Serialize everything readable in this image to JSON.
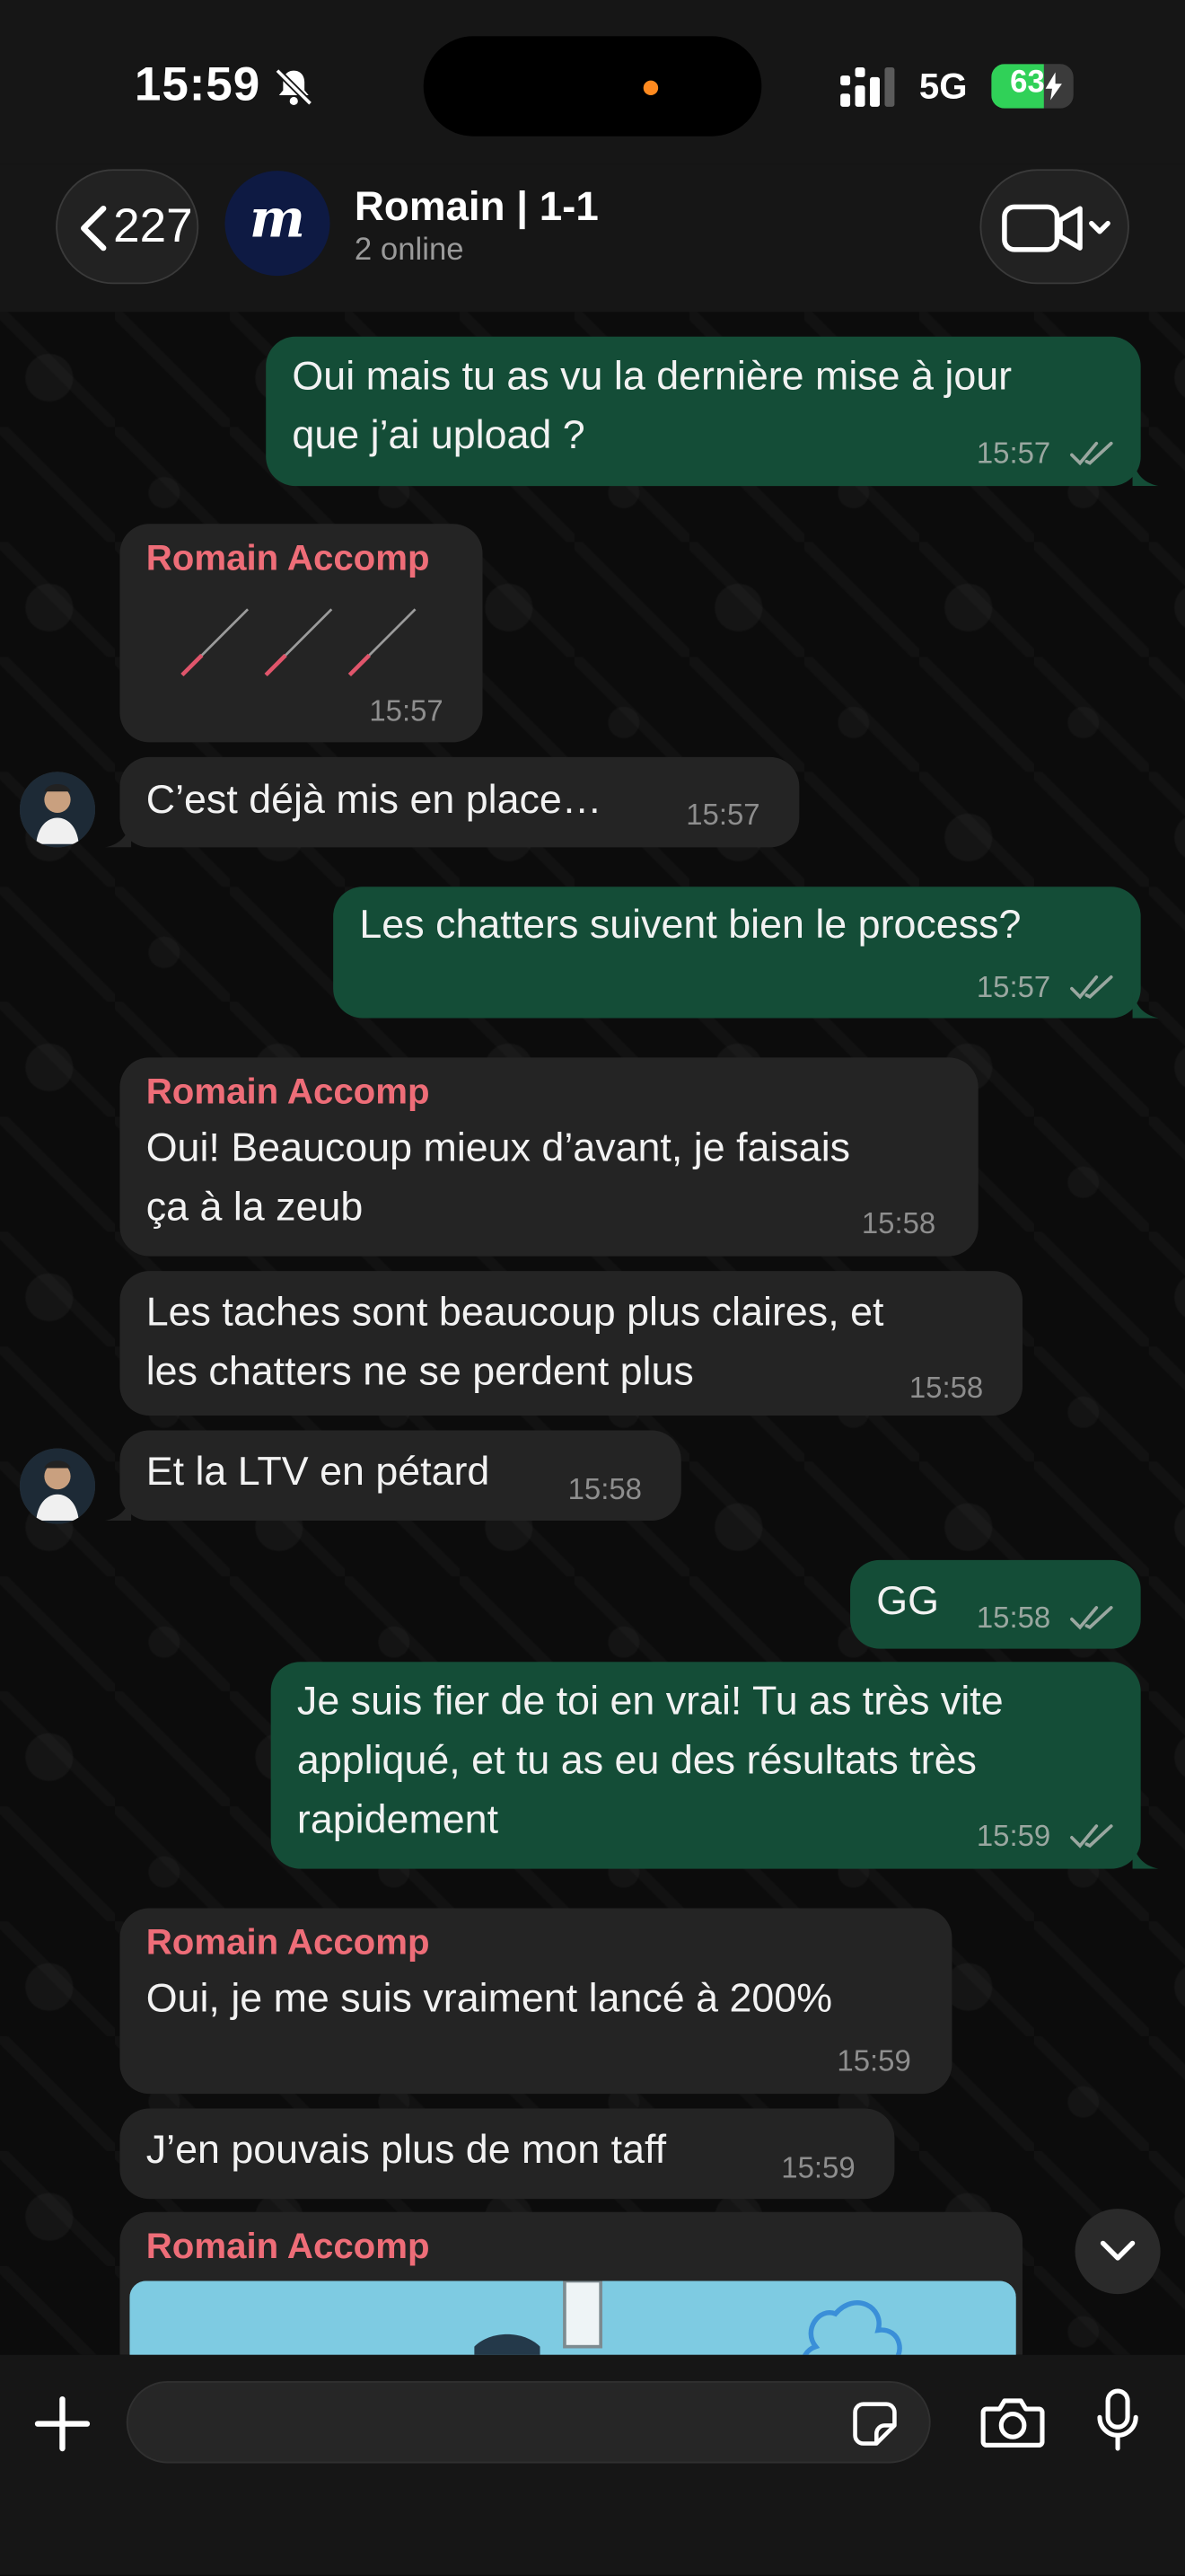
{
  "status_bar": {
    "time": "15:59",
    "network": "5G",
    "battery": "63",
    "battery_level": 0.63
  },
  "header": {
    "back_count": "227",
    "chat_title": "Romain | 1-1",
    "chat_subtitle": "2 online",
    "logo_letter": "m"
  },
  "messages": [
    {
      "dir": "out",
      "lines": [
        "Oui mais tu as vu la dernière mise à jour",
        "que j’ai upload ?"
      ],
      "time": "15:57",
      "status": "read"
    },
    {
      "dir": "in",
      "sender": "Romain Accomp",
      "content": "stickers",
      "time": "15:57"
    },
    {
      "dir": "in",
      "lines": [
        "C’est déjà mis en place…"
      ],
      "time": "15:57"
    },
    {
      "dir": "out",
      "lines": [
        "Les chatters suivent bien le process?"
      ],
      "time": "15:57",
      "status": "read"
    },
    {
      "dir": "in",
      "sender": "Romain Accomp",
      "lines": [
        "Oui! Beaucoup mieux d’avant, je faisais",
        "ça à la zeub"
      ],
      "time": "15:58"
    },
    {
      "dir": "in",
      "lines": [
        "Les taches sont beaucoup plus claires, et",
        "les chatters ne se perdent plus"
      ],
      "time": "15:58"
    },
    {
      "dir": "in",
      "lines": [
        "Et la LTV en pétard"
      ],
      "time": "15:58"
    },
    {
      "dir": "out",
      "lines": [
        "GG"
      ],
      "time": "15:58",
      "status": "read"
    },
    {
      "dir": "out",
      "lines": [
        "Je suis fier de toi en vrai! Tu as très vite",
        "appliqué, et tu as eu des résultats très",
        "rapidement"
      ],
      "time": "15:59",
      "status": "read"
    },
    {
      "dir": "in",
      "sender": "Romain Accomp",
      "lines": [
        "Oui, je me suis vraiment lancé à 200%"
      ],
      "time": "15:59"
    },
    {
      "dir": "in",
      "lines": [
        "J’en pouvais plus de mon taff"
      ],
      "time": "15:59"
    },
    {
      "dir": "in",
      "sender": "Romain Accomp",
      "content": "image"
    }
  ],
  "composer": {
    "placeholder": ""
  },
  "colors": {
    "outgoing": "#144d37",
    "incoming": "#242424",
    "sender": "#ee6d78",
    "battery": "#30d158"
  },
  "icons": [
    "bell-slash-icon",
    "signal-icon",
    "chevron-left-icon",
    "video-camera-icon",
    "chevron-down-icon",
    "double-check-icon",
    "plus-icon",
    "sticker-icon",
    "camera-icon",
    "microphone-icon"
  ]
}
